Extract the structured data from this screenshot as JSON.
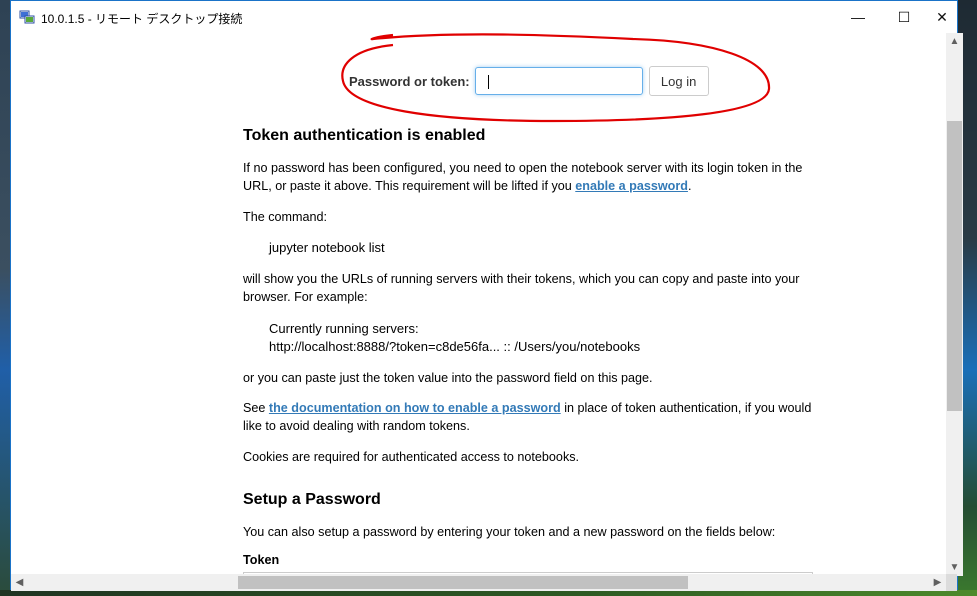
{
  "window": {
    "title": "10.0.1.5 - リモート デスクトップ接続",
    "minimize": "—",
    "maximize": "☐",
    "close": "✕"
  },
  "login": {
    "label": "Password or token:",
    "input_value": "",
    "button": "Log in"
  },
  "doc": {
    "heading1": "Token authentication is enabled",
    "p1_text": "If no password has been configured, you need to open the notebook server with its login token in the URL, or paste it above. This requirement will be lifted if you ",
    "p1_link": "enable a password",
    "p1_end": ".",
    "p2": "The command:",
    "cmd": "jupyter notebook list",
    "p3": "will show you the URLs of running servers with their tokens, which you can copy and paste into your browser. For example:",
    "example_line1": "Currently running servers:",
    "example_line2": "http://localhost:8888/?token=c8de56fa... :: /Users/you/notebooks",
    "p4": "or you can paste just the token value into the password field on this page.",
    "p5_start": "See ",
    "p5_link": "the documentation on how to enable a password",
    "p5_end": " in place of token authentication, if you would like to avoid dealing with random tokens.",
    "p6": "Cookies are required for authenticated access to notebooks.",
    "heading2": "Setup a Password",
    "p7": "You can also setup a password by entering your token and a new password on the fields below:",
    "token_label": "Token"
  },
  "scroll": {
    "up": "▲",
    "down": "▼",
    "left": "◀",
    "right": "▶"
  },
  "colors": {
    "link": "#337ab7",
    "annotation": "#e00000",
    "window_border": "#1a73c8"
  }
}
